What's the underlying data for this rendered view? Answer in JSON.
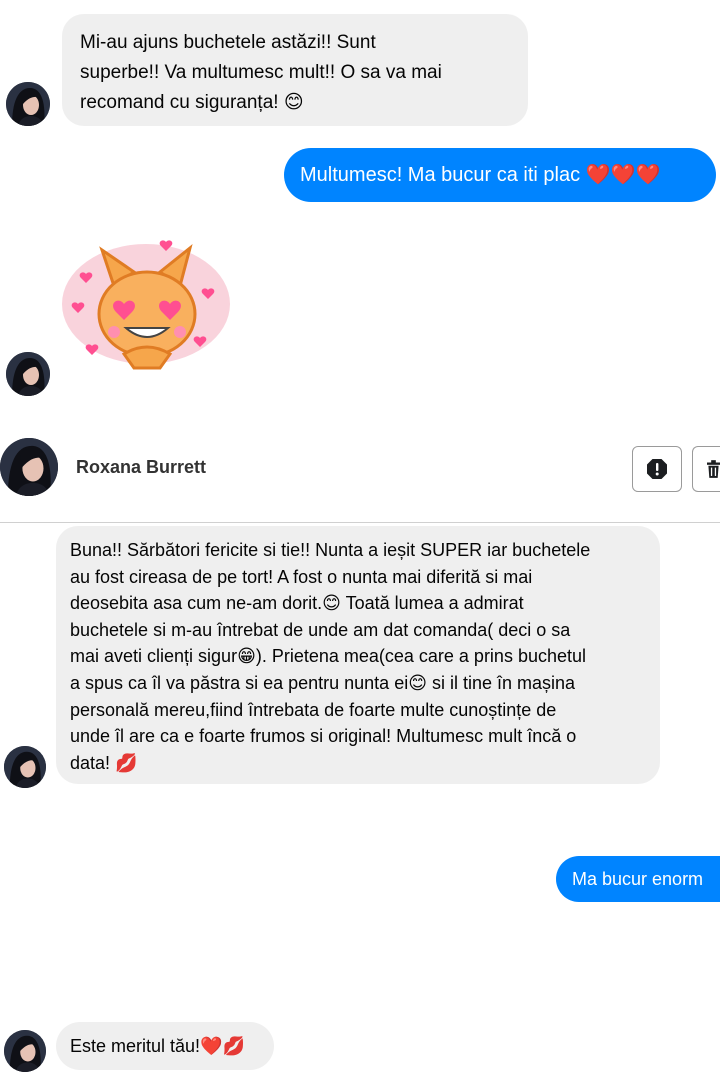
{
  "conversation1": {
    "incoming_1": "Mi-au ajuns buchetele astăzi!! Sunt\nsuperbe!! Va multumesc mult!! O sa va mai\nrecomand cu siguranța! 😊",
    "outgoing_1": "Multumesc! Ma bucur ca iti plac ❤️❤️❤️",
    "sticker_name": "cat-heart-eyes-sticker"
  },
  "header": {
    "user_name": "Roxana Burrett",
    "report_icon": "exclamation-octagon-icon",
    "delete_icon": "trash-icon"
  },
  "conversation2": {
    "incoming_long": "Buna!! Sărbători fericite si tie!! Nunta a ieșit SUPER iar buchetele\nau fost cireasa de pe tort! A fost o nunta mai diferită si mai\ndeosebita asa cum ne-am dorit.😊 Toată lumea a admirat\nbuchetele si m-au întrebat de unde am dat comanda( deci o sa\nmai aveti clienți sigur😁). Prietena mea(cea care a prins buchetul\na spus ca îl va păstra si ea pentru nunta ei😊 si il tine în mașina\npersonală mereu,fiind întrebata de foarte multe cunoștințe de\nunde îl are ca e foarte frumos si original! Multumesc mult încă o\ndata! 💋",
    "outgoing": "Ma bucur enorm",
    "incoming_short": "Este meritul tău!❤️💋"
  },
  "colors": {
    "outgoing_bg": "#0084ff",
    "incoming_bg": "#efefef"
  }
}
